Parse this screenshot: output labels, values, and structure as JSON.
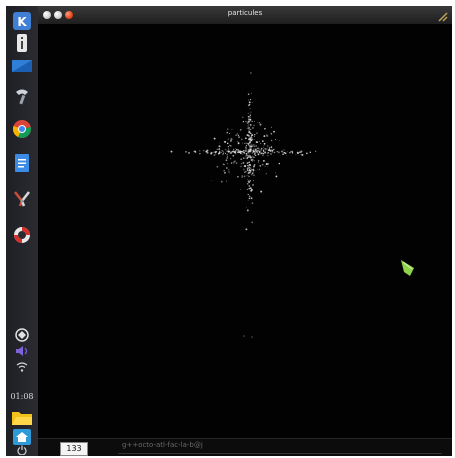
{
  "window": {
    "title": "particules"
  },
  "dock": {
    "items": [
      {
        "icon": "kde-launcher-icon"
      },
      {
        "icon": "info-icon"
      },
      {
        "icon": "blue-folder-icon"
      },
      {
        "icon": "magnet-tool-icon"
      },
      {
        "icon": "chrome-icon"
      },
      {
        "icon": "document-icon"
      },
      {
        "icon": "pliers-icon"
      },
      {
        "icon": "lifebuoy-icon"
      },
      {
        "icon": "network-icon"
      },
      {
        "icon": "volume-icon"
      },
      {
        "icon": "wifi-icon"
      },
      {
        "icon": "folder-icon"
      },
      {
        "icon": "home-icon"
      },
      {
        "icon": "power-icon"
      }
    ],
    "clock": "01:08"
  },
  "bottom": {
    "counter": "133",
    "status_text": "g++octo-atl-fac-la-b@j"
  },
  "colors": {
    "background": "#020202",
    "particles": "#d9d9d9",
    "marker": "#8fd24a"
  }
}
